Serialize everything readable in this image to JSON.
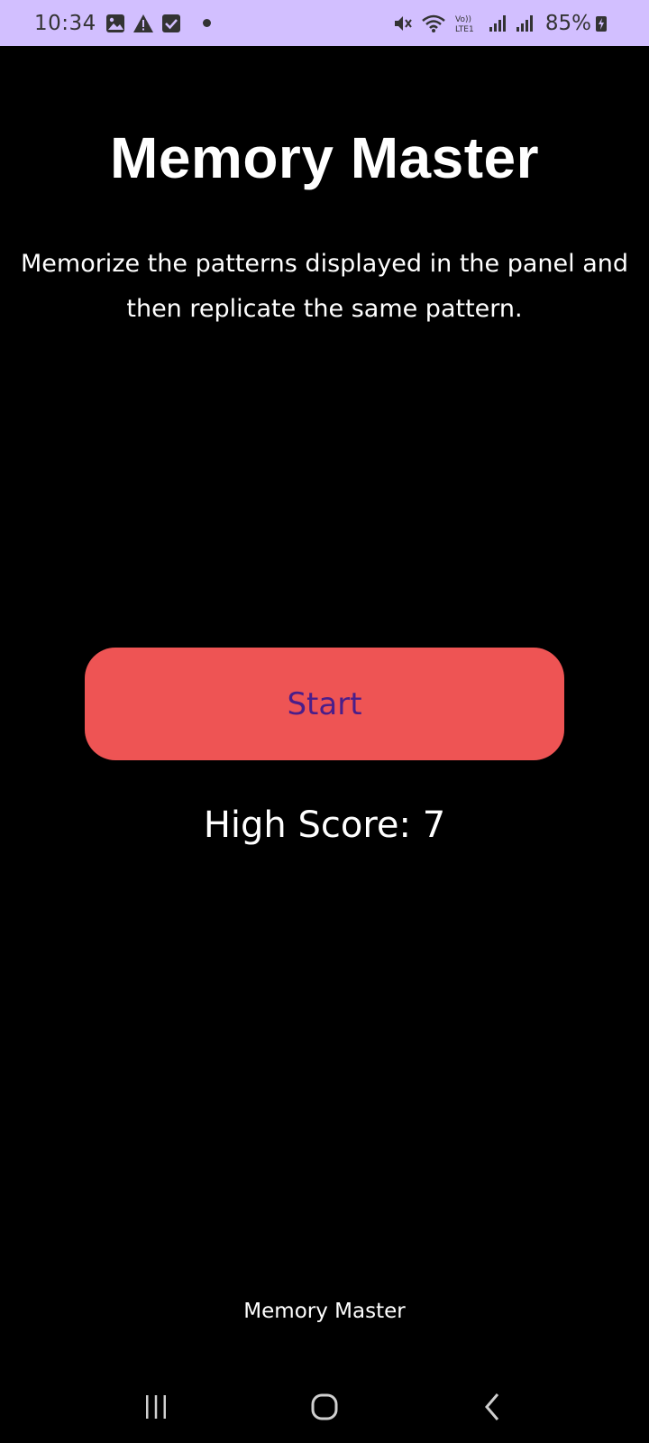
{
  "status_bar": {
    "time": "10:34",
    "battery": "85%",
    "icons": [
      "gallery-icon",
      "warning-icon",
      "check-icon",
      "dot-icon",
      "mute-icon",
      "wifi-icon",
      "volte-icon",
      "signal-icon",
      "signal-icon",
      "battery-charging-icon"
    ],
    "background": "#d2bfff"
  },
  "main": {
    "title": "Memory Master",
    "description": "Memorize the patterns displayed in the panel and then replicate the same pattern.",
    "start_button": "Start",
    "high_score": "High Score: 7",
    "button_color": "#ee5454",
    "button_text_color": "#4a1e8a"
  },
  "footer": {
    "app_name": "Memory Master"
  },
  "nav": {
    "buttons": [
      "recents-icon",
      "home-icon",
      "back-icon"
    ]
  }
}
